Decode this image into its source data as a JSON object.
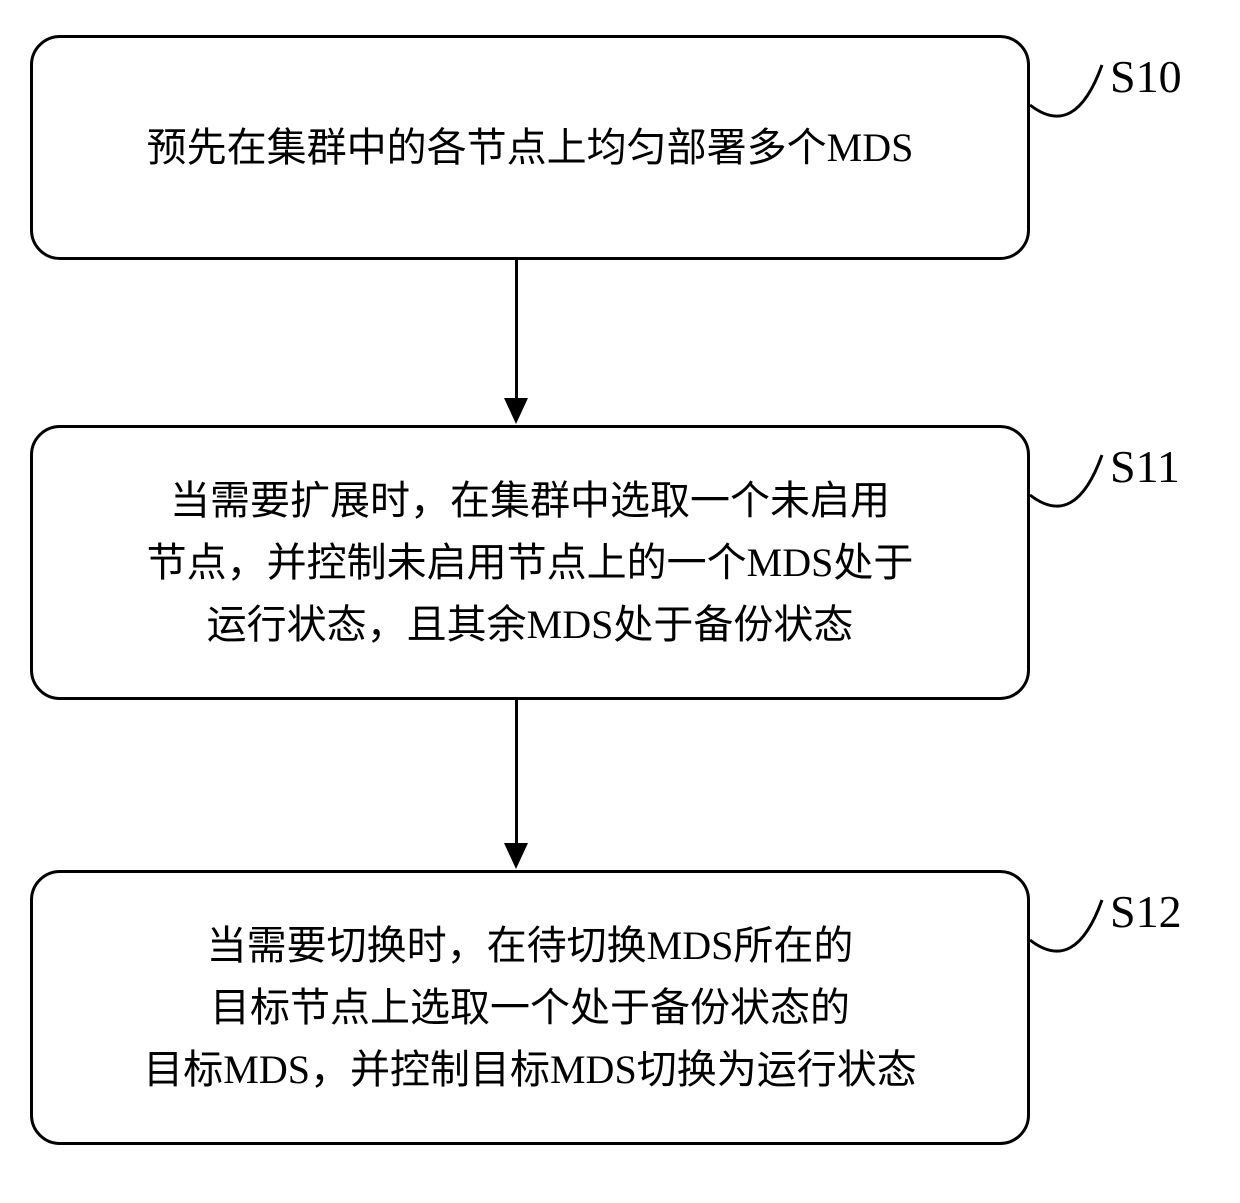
{
  "steps": [
    {
      "id": "S10",
      "text": "预先在集群中的各节点上均匀部署多个MDS"
    },
    {
      "id": "S11",
      "text": "当需要扩展时，在集群中选取一个未启用\n节点，并控制未启用节点上的一个MDS处于\n运行状态，且其余MDS处于备份状态"
    },
    {
      "id": "S12",
      "text": "当需要切换时，在待切换MDS所在的\n目标节点上选取一个处于备份状态的\n目标MDS，并控制目标MDS切换为运行状态"
    }
  ],
  "diagram": {
    "type": "flowchart",
    "direction": "top-to-bottom",
    "node_count": 3
  }
}
